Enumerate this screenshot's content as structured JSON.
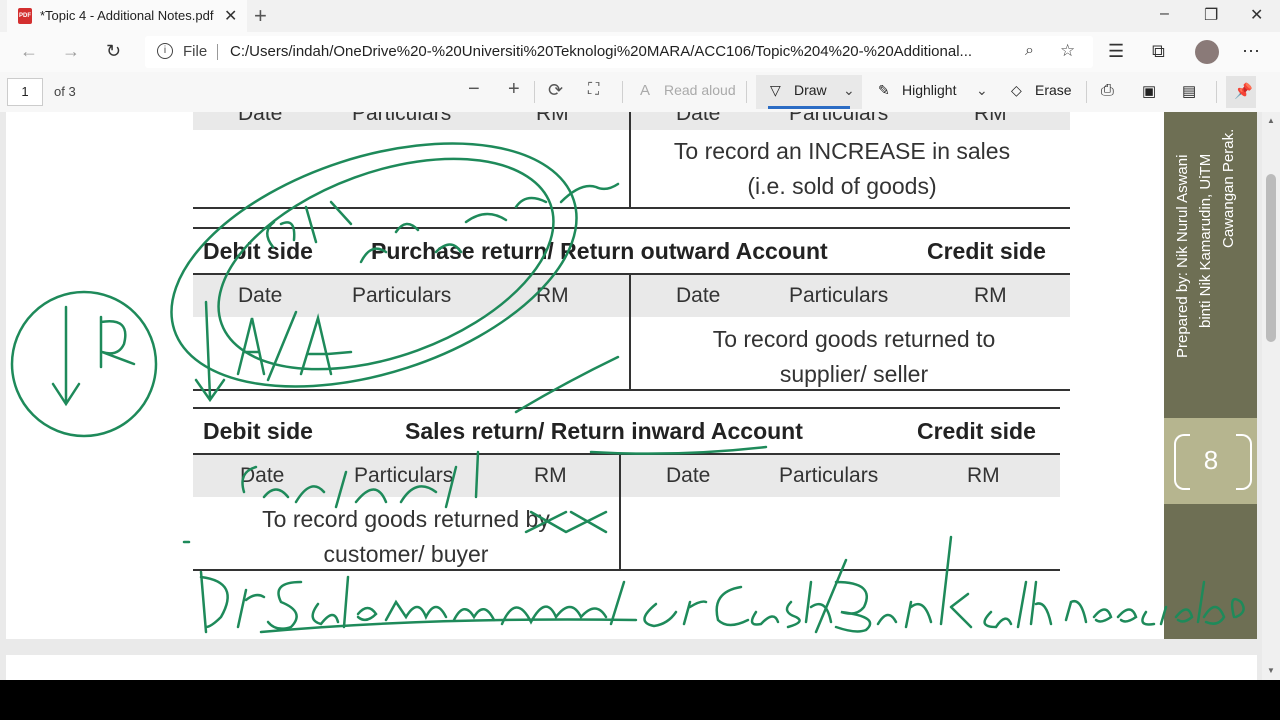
{
  "browser": {
    "tab_title": "*Topic 4 - Additional Notes.pdf",
    "tab_close": "✕",
    "new_tab": "+",
    "file_label": "File",
    "url": "C:/Users/indah/OneDrive%20-%20Universiti%20Teknologi%20MARA/ACC106/Topic%204%20-%20Additional...",
    "window_buttons": [
      "–",
      "❐",
      "✕"
    ]
  },
  "pdf_toolbar": {
    "page_number": "1",
    "page_count": "of 3",
    "read_aloud": "Read aloud",
    "draw": "Draw",
    "highlight": "Highlight",
    "erase": "Erase"
  },
  "document": {
    "partial_header": {
      "date": "Date",
      "particulars": "Particulars",
      "rm": "RM"
    },
    "partial_note": "To record an INCREASE in sales\n(i.e. sold of goods)",
    "purchase_return": {
      "debit": "Debit side",
      "title": "Purchase return/ Return outward Account",
      "credit": "Credit side",
      "date": "Date",
      "particulars": "Particulars",
      "rm": "RM",
      "note": "To record goods returned to\nsupplier/ seller"
    },
    "sales_return": {
      "debit": "Debit side",
      "title": "Sales return/ Return inward Account",
      "credit": "Credit side",
      "date": "Date",
      "particulars": "Particulars",
      "rm": "RM",
      "note": "To record goods returned by\ncustomer/ buyer"
    },
    "side_text_1": "Prepared by: Nik Nurul Aswani",
    "side_text_2": "binti Nik Kamarudin, UiTM",
    "side_text_3": "Cawangan Perak.",
    "page_label": "8"
  },
  "colors": {
    "ink": "#1e8a5a",
    "side_band": "#6e6f54",
    "side_band_light": "#b6b58f"
  }
}
